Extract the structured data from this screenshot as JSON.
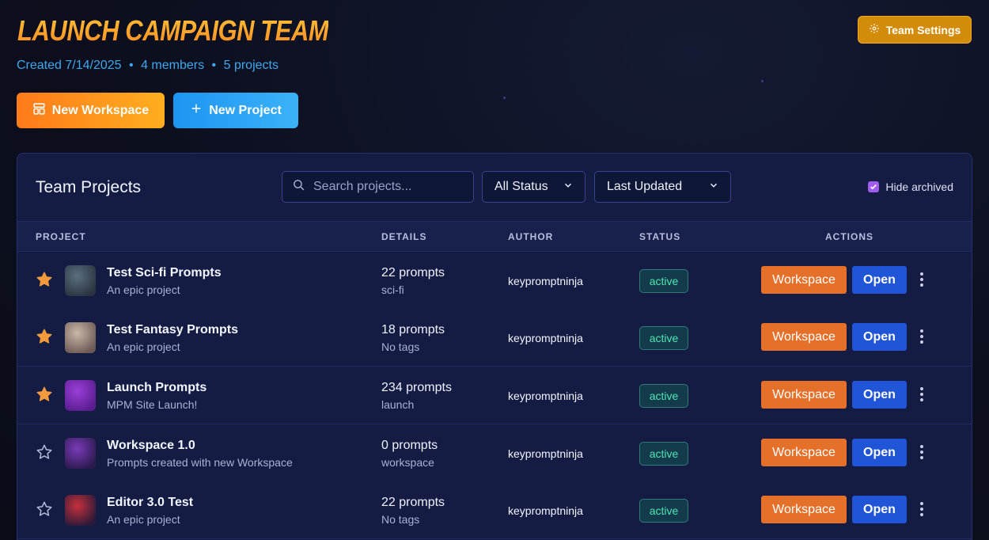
{
  "header": {
    "title": "LAUNCH CAMPAIGN TEAM",
    "created": "Created 7/14/2025",
    "separator": "•",
    "members": "4 members",
    "projects": "5 projects",
    "settings_label": "Team Settings"
  },
  "actions": {
    "new_workspace": "New Workspace",
    "new_project": "New Project"
  },
  "panel": {
    "title": "Team Projects",
    "search_placeholder": "Search projects...",
    "status_filter": "All Status",
    "sort": "Last Updated",
    "hide_archived_label": "Hide archived",
    "hide_archived_checked": true
  },
  "table": {
    "headers": {
      "project": "PROJECT",
      "details": "DETAILS",
      "author": "AUTHOR",
      "status": "STATUS",
      "actions": "ACTIONS"
    },
    "rows": [
      {
        "starred": true,
        "name": "Test Sci-fi Prompts",
        "description": "An epic project",
        "prompts": "22 prompts",
        "tag": "sci-fi",
        "author": "keypromptninja",
        "status": "active",
        "workspace_label": "Workspace",
        "open_label": "Open",
        "thumb": [
          "#5b6f7e",
          "#2a3440"
        ]
      },
      {
        "starred": true,
        "name": "Test Fantasy Prompts",
        "description": "An epic project",
        "prompts": "18 prompts",
        "tag": "No tags",
        "author": "keypromptninja",
        "status": "active",
        "workspace_label": "Workspace",
        "open_label": "Open",
        "thumb": [
          "#c9b7a8",
          "#6d5a55"
        ]
      },
      {
        "starred": true,
        "name": "Launch Prompts",
        "description": "MPM Site Launch!",
        "prompts": "234 prompts",
        "tag": "launch",
        "author": "keypromptninja",
        "status": "active",
        "workspace_label": "Workspace",
        "open_label": "Open",
        "thumb": [
          "#9a3fd8",
          "#5a1d8f"
        ]
      },
      {
        "starred": false,
        "name": "Workspace 1.0",
        "description": "Prompts created with new Workspace",
        "prompts": "0 prompts",
        "tag": "workspace",
        "author": "keypromptninja",
        "status": "active",
        "workspace_label": "Workspace",
        "open_label": "Open",
        "thumb": [
          "#7a3bb8",
          "#2c1a4e"
        ]
      },
      {
        "starred": false,
        "name": "Editor 3.0 Test",
        "description": "An epic project",
        "prompts": "22 prompts",
        "tag": "No tags",
        "author": "keypromptninja",
        "status": "active",
        "workspace_label": "Workspace",
        "open_label": "Open",
        "thumb": [
          "#c7303b",
          "#2a1a3a"
        ]
      }
    ]
  },
  "colors": {
    "accent_orange": "#e5702a",
    "accent_blue": "#1f55d6",
    "star_filled": "#f39a3c",
    "status_active": "#4ee6b2"
  }
}
